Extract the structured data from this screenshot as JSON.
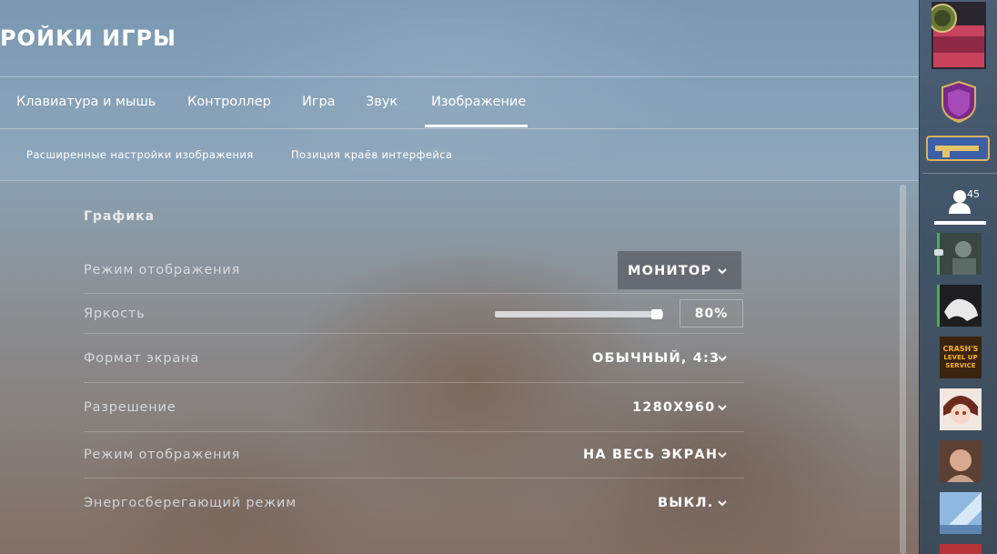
{
  "header": {
    "title": "РОЙКИ ИГРЫ",
    "tabs": [
      {
        "label": "Клавиатура и мышь"
      },
      {
        "label": "Контроллер"
      },
      {
        "label": "Игра"
      },
      {
        "label": "Звук"
      },
      {
        "label": "Изображение",
        "active": true
      }
    ],
    "subtabs": [
      {
        "label": "Расширенные настройки изображения"
      },
      {
        "label": "Позиция краёв интерфейса"
      }
    ]
  },
  "settings": {
    "section_title": "Графика",
    "rows": [
      {
        "label": "Режим отображения",
        "value": "МОНИТОР"
      },
      {
        "label": "Яркость",
        "value": "80%",
        "slider_fraction": 0.93
      },
      {
        "label": "Формат экрана",
        "value": "ОБЫЧНЫЙ, 4:3"
      },
      {
        "label": "Разрешение",
        "value": "1280X960"
      },
      {
        "label": "Режим отображения",
        "value": "НА ВЕСЬ ЭКРАН"
      },
      {
        "label": "Энергосберегающий режим",
        "value": "ВЫКЛ."
      }
    ]
  },
  "sidebar": {
    "friends_count": "45",
    "friend_avatars": [
      {
        "name": "friend-avatar-1",
        "online": true
      },
      {
        "name": "friend-avatar-2",
        "online": true
      },
      {
        "name": "friend-avatar-3",
        "text": "CRASH'S LEVEL UP SERVICE"
      },
      {
        "name": "friend-avatar-4"
      },
      {
        "name": "friend-avatar-5"
      },
      {
        "name": "friend-avatar-6"
      }
    ]
  },
  "colors": {
    "online": "#4caf50",
    "accent_white": "#ffffff"
  }
}
